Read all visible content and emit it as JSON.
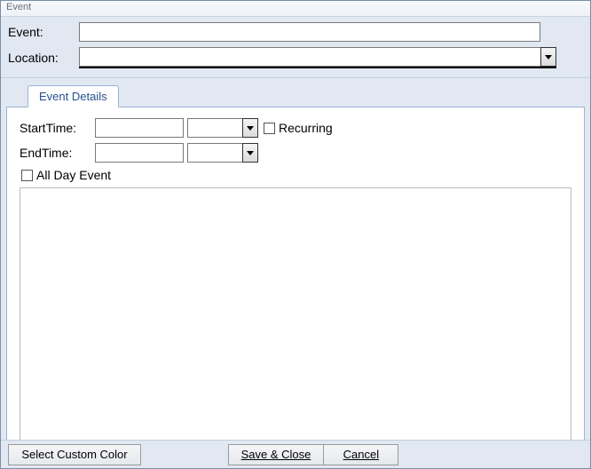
{
  "window": {
    "title": "Event"
  },
  "header": {
    "event_label": "Event:",
    "event_value": "",
    "location_label": "Location:",
    "location_value": ""
  },
  "tabs": [
    {
      "label": "Event Details"
    }
  ],
  "details": {
    "start_label": "StartTime:",
    "start_date": "",
    "start_time": "",
    "end_label": "EndTime:",
    "end_date": "",
    "end_time": "",
    "recurring_label": "Recurring",
    "recurring_checked": false,
    "allday_label": "All Day Event",
    "allday_checked": false,
    "notes": ""
  },
  "footer": {
    "select_color_label": "Select Custom Color",
    "save_label": "Save & Close",
    "cancel_label": "Cancel"
  }
}
